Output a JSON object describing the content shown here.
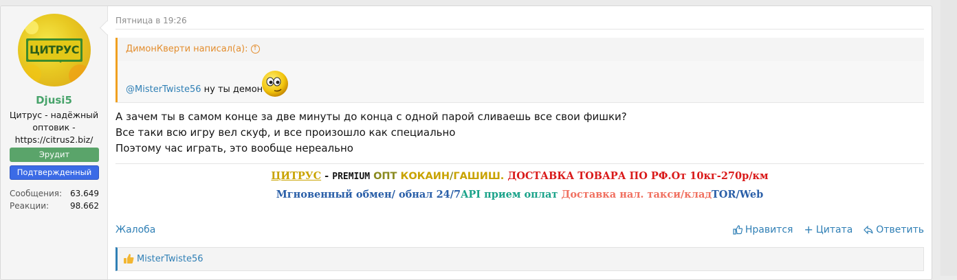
{
  "user": {
    "avatar_text": "ЦИТРУС",
    "username": "Djusi5",
    "title": "Цитрус - надёжный оптовик - https://citrus2.biz/",
    "banners": [
      {
        "label": "Эрудит",
        "color": "#5aa46a"
      },
      {
        "label": "Подтвержденный",
        "color": "#3b6be6"
      }
    ],
    "stats": [
      {
        "label": "Сообщения:",
        "value": "63.649"
      },
      {
        "label": "Реакции:",
        "value": "98.662"
      }
    ]
  },
  "post": {
    "date": "Пятница в 19:26",
    "quote": {
      "author": "ДимонКверти написал(а):",
      "mention": "@MisterTwiste56",
      "text": " ну ты демон"
    },
    "message_lines": [
      "А зачем ты в самом конце за две минуты до конца с одной парой сливаешь все свои фишки?",
      "Все таки всю игру вел скуф, и все произошло как специально",
      "Поэтому час играть, это вообще нереально"
    ],
    "signature": {
      "row1": [
        "ЦИТРУС",
        " - ",
        "PREMIUM",
        " ОПТ ",
        "КОКАИН",
        "/",
        "ГАШИШ.",
        " ДОСТАВКА ТОВАРА ПО РФ.От 10кг-270р/км"
      ],
      "row2": [
        "Мгновенный обмен/ обнал 24/7",
        "API прием оплат",
        " Доставка нал. такси/клад",
        "TOR/Web"
      ]
    },
    "actions": {
      "report": "Жалоба",
      "like": "Нравится",
      "quote": "Цитата",
      "reply": "Ответить"
    },
    "likes_by": "MisterTwiste56"
  },
  "colors": {
    "accent": "#2f7fb5",
    "username": "#47a36a",
    "quote_border": "#f0a020"
  }
}
